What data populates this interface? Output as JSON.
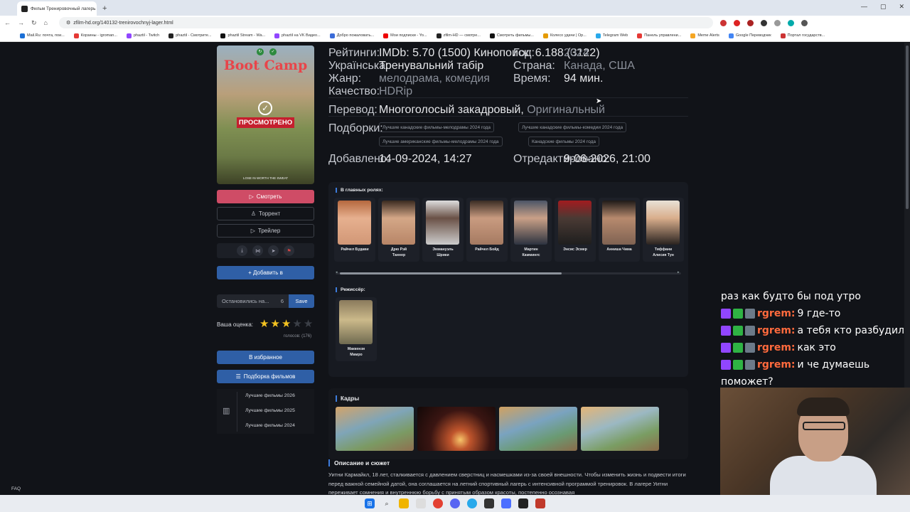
{
  "browser": {
    "tab_title": "Фильм Тренировочный лагерь",
    "url": "zfilm-hd.org/140132-trenirovochnyj-lager.html",
    "bookmarks": [
      "Mail.Ru: почта, пои...",
      "Корзины - igroman...",
      "phaztil - Twitch",
      "phaztil - Смотрите...",
      "phaztil Stream - Wa...",
      "phaztil на VK Видео...",
      "Добро пожаловать...",
      "Мои подписки - Yo...",
      "zfilm-HD — смотре...",
      "Смотреть фильмы...",
      "Колесо удачи | Op...",
      "Telegram Web",
      "Панель управлени...",
      "Meme Alerts",
      "Google Переводчик",
      "Портал государств..."
    ]
  },
  "poster": {
    "title": "Boot Camp",
    "watched": "ПРОСМОТРЕНО",
    "tagline": "LOSE IN WORTH THE SWEAT"
  },
  "sidebar": {
    "watch": "Смотреть",
    "torrent": "Торрент",
    "trailer": "Трейлер",
    "add": "+ Добавить в",
    "stopped_label": "Остановились на...",
    "stopped_value": "6",
    "save": "Save",
    "rating_label": "Ваша оценка:",
    "stars_value": 3,
    "stars_max": 5,
    "votes": "голосов: (176)",
    "favorites": "В избранное",
    "collection": "Подборка фильмов",
    "lists": [
      "Лучшие фильмы 2026",
      "Лучшие фильмы 2025",
      "Лучшие фильмы 2024"
    ],
    "faq": "FAQ"
  },
  "meta": {
    "ratings_k": "Рейтинги:",
    "ratings_v": "IMDb: 5.70 (1500) Кинопоиск: 6.188 (3122)",
    "year_k": "Год:",
    "year_v": "2024",
    "ua_k": "Украïнська:",
    "ua_v": "Тренувальний табір",
    "country_k": "Страна:",
    "country_v": "Канада, США",
    "genre_k": "Жанр:",
    "genre_v": "мелодрама, комедия",
    "time_k": "Время:",
    "time_v": "94 мин.",
    "quality_k": "Качество:",
    "quality_v": "HDRip",
    "transl_k": "Перевод:",
    "transl_v": "Многоголосый закадровый,",
    "transl_v2": "Оригинальный",
    "coll_k": "Подборки:",
    "chips": [
      "Лучшие канадские фильмы-мелодрамы 2024 года",
      "Лучшие канадские фильмы-комедии 2024 года",
      "Лучшие американские фильмы-мелодрамы 2024 года",
      "Канадские фильмы 2024 года"
    ],
    "added_k": "Добавлено:",
    "added_v": "14-09-2024, 14:27",
    "edited_k": "Отредактировано:",
    "edited_v": "9-06-2026, 21:00"
  },
  "cast": {
    "title": "В главных ролях:",
    "actors": [
      [
        "Райчел Будави",
        ""
      ],
      [
        "Дрю Рэй",
        "Таннер"
      ],
      [
        "Эммануэль",
        "Шрики"
      ],
      [
        "Райчел Бойд",
        ""
      ],
      [
        "Мартин",
        "Каммингс"
      ],
      [
        "Энсис Эсмер",
        ""
      ],
      [
        "Анниша Чима",
        ""
      ],
      [
        "Тиффани",
        "Алисия Тун"
      ]
    ],
    "director_title": "Режиссёр:",
    "director": [
      "Маккензи",
      "Мамро"
    ]
  },
  "frames_title": "Кадры",
  "desc": {
    "title": "Описание и сюжет",
    "text": "Уитни Кармайкл, 18 лет, сталкивается с давлением сверстниц и насмешками из-за своей внешности. Чтобы изменить жизнь и подвести итоги перед важной семейной датой, она соглашается на летний спортивный лагерь с интенсивной программой тренировок. В лагере Уитни переживает сомнения и внутреннюю борьбу с принятым образом красоты, постепенно осознавая"
  },
  "chat": [
    {
      "user": "",
      "msg": "раз как будто бы под утро"
    },
    {
      "user": "rgrem:",
      "msg": "9 где-то"
    },
    {
      "user": "rgrem:",
      "msg": "а тебя кто разбудил"
    },
    {
      "user": "rgrem:",
      "msg": "как это"
    },
    {
      "user": "rgrem:",
      "msg": "и че думаешь"
    },
    {
      "user": "",
      "msg": "поможет?"
    }
  ],
  "colors": {
    "accent": "#cf4c66",
    "blue": "#2f5fa6",
    "star": "#f3c221",
    "chat_user": "#ff6a3d"
  }
}
